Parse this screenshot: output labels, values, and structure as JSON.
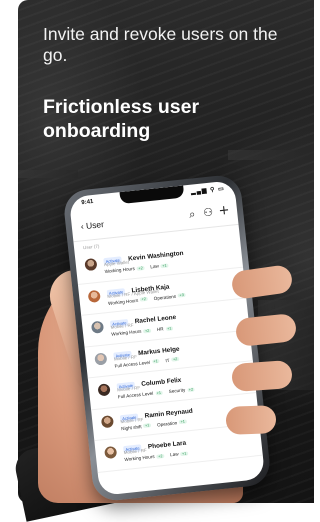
{
  "promo": {
    "headline": "Invite and revoke users on the go.",
    "title": "Frictionless user onboarding"
  },
  "phone": {
    "status_time": "9:41",
    "status_icons": "▂▄▆ ⚲ ▭",
    "nav": {
      "back_label": "‹ User",
      "search_icon": "⌕",
      "filter_icon": "⚇",
      "add_icon": "+"
    },
    "section_label": "User (7)",
    "users": [
      {
        "badge": "Activate",
        "name": "Kevin Washington",
        "meta": "Apple Wallet",
        "tags": [
          {
            "label": "Working Hours",
            "plus": "+2"
          },
          {
            "label": "Law",
            "plus": "+1"
          }
        ]
      },
      {
        "badge": "Activate",
        "name": "Lisbeth Kaja",
        "meta": "Mobile / RF / Apple Wallet",
        "tags": [
          {
            "label": "Working Hours",
            "plus": "+2"
          },
          {
            "label": "Operations",
            "plus": "+3"
          }
        ]
      },
      {
        "badge": "Activate",
        "name": "Rachel Leone",
        "meta": "Mobile / RF",
        "tags": [
          {
            "label": "Working Hours",
            "plus": "+2"
          },
          {
            "label": "HR",
            "plus": "+1"
          }
        ]
      },
      {
        "badge": "Activate",
        "name": "Markus Helge",
        "meta": "Mobile / RF",
        "tags": [
          {
            "label": "Full Access Level",
            "plus": "+1"
          },
          {
            "label": "IT",
            "plus": "+2"
          }
        ]
      },
      {
        "badge": "Activate",
        "name": "Columb Felix",
        "meta": "Mobile / RF",
        "tags": [
          {
            "label": "Full Access Level",
            "plus": "+1"
          },
          {
            "label": "Security",
            "plus": "+2"
          }
        ]
      },
      {
        "badge": "Activate",
        "name": "Ramin Reynaud",
        "meta": "Mobile / RF",
        "tags": [
          {
            "label": "Night shift",
            "plus": "+1"
          },
          {
            "label": "Operation",
            "plus": "+1"
          }
        ]
      },
      {
        "badge": "Activate",
        "name": "Phoebe Lara",
        "meta": "Mobile / RF",
        "tags": [
          {
            "label": "Working Hours",
            "plus": "+2"
          },
          {
            "label": "Law",
            "plus": "+1"
          }
        ]
      }
    ]
  }
}
